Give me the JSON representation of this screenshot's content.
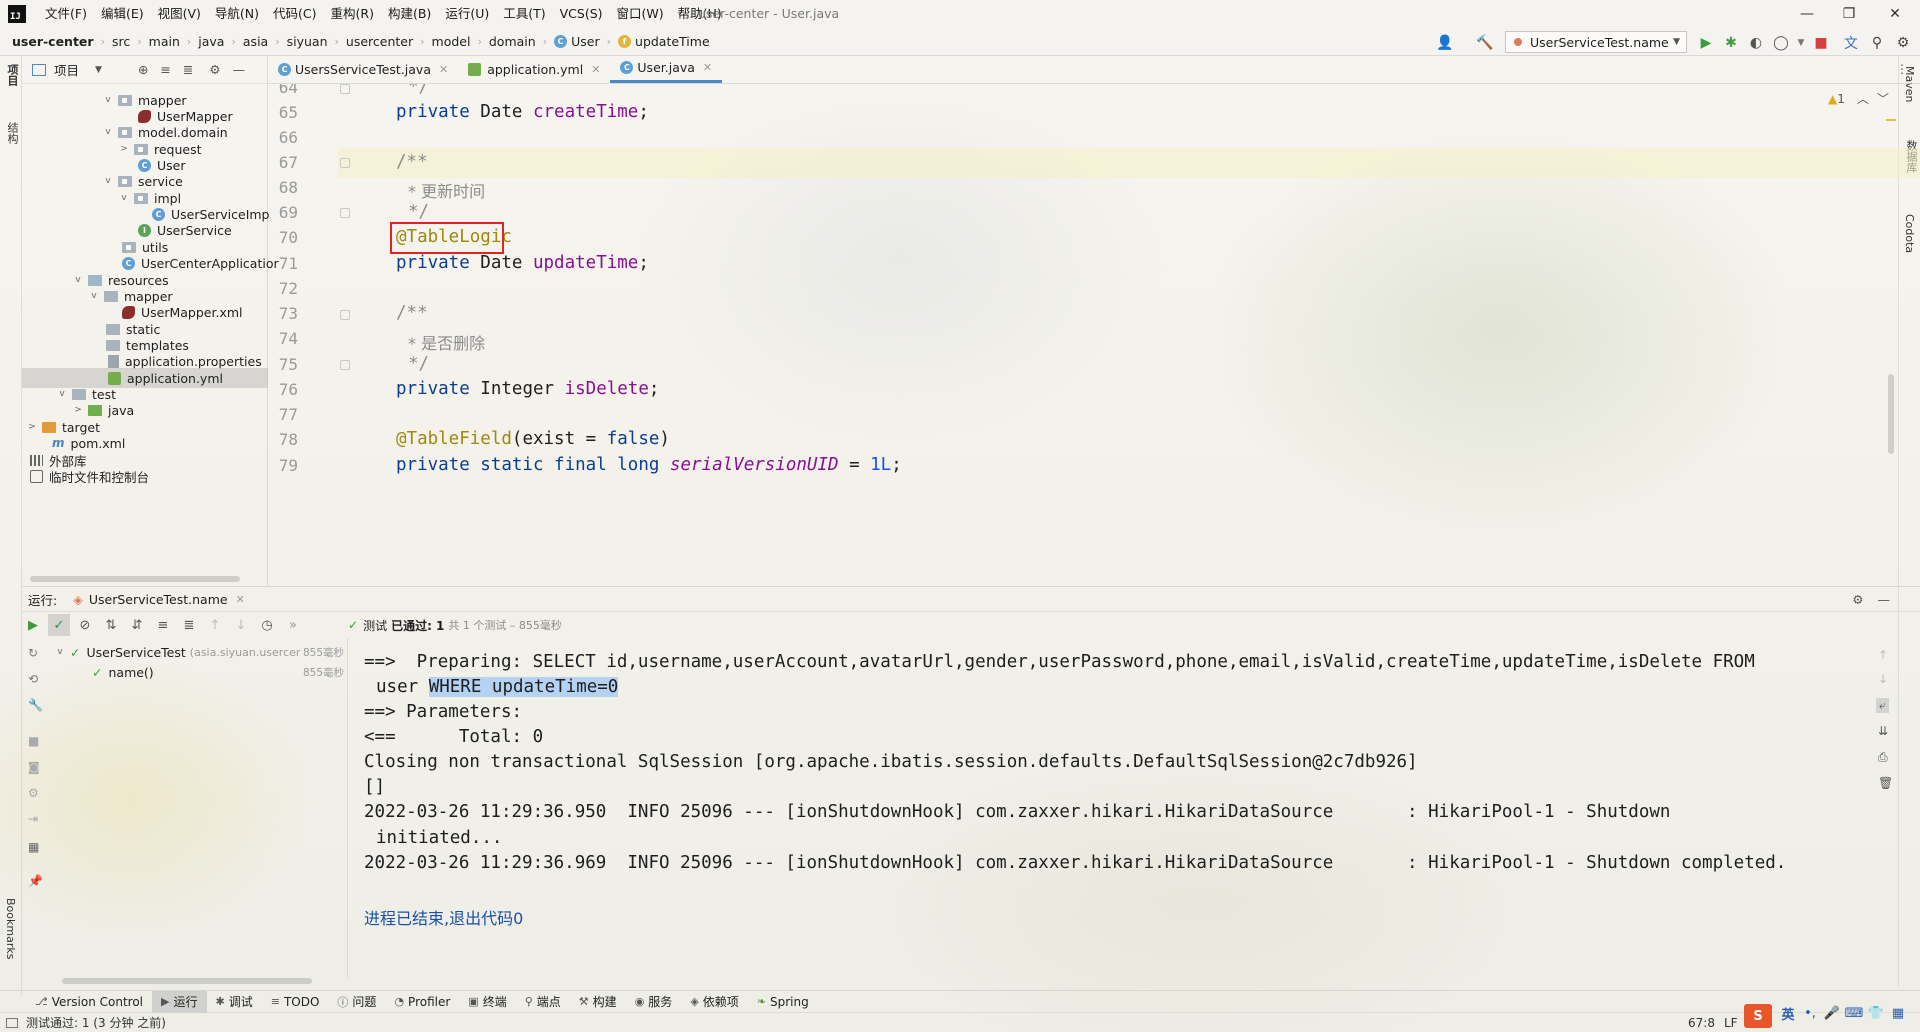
{
  "window": {
    "title": "user-center - User.java",
    "app_logo": "IJ"
  },
  "menu": [
    "文件(F)",
    "编辑(E)",
    "视图(V)",
    "导航(N)",
    "代码(C)",
    "重构(R)",
    "构建(B)",
    "运行(U)",
    "工具(T)",
    "VCS(S)",
    "窗口(W)",
    "帮助(H)"
  ],
  "breadcrumb": [
    "user-center",
    "src",
    "main",
    "java",
    "asia",
    "siyuan",
    "usercenter",
    "model",
    "domain",
    "User",
    "updateTime"
  ],
  "run_config": "UserServiceTest.name",
  "left_strip": {
    "project": "项目",
    "structure": "结构",
    "bookmarks": "Bookmarks"
  },
  "right_strip": {
    "maven": "Maven",
    "database": "数据库",
    "codota": "Codota"
  },
  "project_panel": {
    "title": "项目",
    "tree": [
      {
        "label": "mapper",
        "icon": "folder-icon"
      },
      {
        "label": "UserMapper",
        "icon": "mapper-icon"
      },
      {
        "label": "model.domain",
        "icon": "folder-icon"
      },
      {
        "label": "request",
        "icon": "folder-icon"
      },
      {
        "label": "User",
        "icon": "class-icon"
      },
      {
        "label": "service",
        "icon": "folder-icon"
      },
      {
        "label": "impl",
        "icon": "folder-icon"
      },
      {
        "label": "UserServiceImp",
        "icon": "class-icon"
      },
      {
        "label": "UserService",
        "icon": "interface-icon"
      },
      {
        "label": "utils",
        "icon": "folder-icon"
      },
      {
        "label": "UserCenterApplicatior",
        "icon": "class-icon"
      },
      {
        "label": "resources",
        "icon": "resources-folder-icon"
      },
      {
        "label": "mapper",
        "icon": "folder-icon"
      },
      {
        "label": "UserMapper.xml",
        "icon": "mybatis-xml-icon"
      },
      {
        "label": "static",
        "icon": "folder-icon"
      },
      {
        "label": "templates",
        "icon": "folder-icon"
      },
      {
        "label": "application.properties",
        "icon": "properties-icon"
      },
      {
        "label": "application.yml",
        "icon": "yaml-icon"
      },
      {
        "label": "test",
        "icon": "folder-icon"
      },
      {
        "label": "java",
        "icon": "test-folder-icon"
      },
      {
        "label": "target",
        "icon": "excluded-folder-icon"
      },
      {
        "label": "pom.xml",
        "icon": "maven-icon"
      },
      {
        "label": "外部库",
        "icon": "library-icon"
      },
      {
        "label": "临时文件和控制台",
        "icon": "scratch-icon"
      }
    ]
  },
  "tabs": [
    {
      "label": "UsersServiceTest.java",
      "active": false
    },
    {
      "label": "application.yml",
      "active": false
    },
    {
      "label": "User.java",
      "active": true
    }
  ],
  "editor": {
    "warning_count": "1",
    "lines": [
      {
        "n": "64",
        "text": "*/"
      },
      {
        "n": "65",
        "text": "private Date createTime;"
      },
      {
        "n": "66",
        "text": ""
      },
      {
        "n": "67",
        "text": "/**"
      },
      {
        "n": "68",
        "text": "* 更新时间"
      },
      {
        "n": "69",
        "text": "*/"
      },
      {
        "n": "70",
        "text": "@TableLogic"
      },
      {
        "n": "71",
        "text": "private Date updateTime;"
      },
      {
        "n": "72",
        "text": ""
      },
      {
        "n": "73",
        "text": "/**"
      },
      {
        "n": "74",
        "text": "* 是否删除"
      },
      {
        "n": "75",
        "text": "*/"
      },
      {
        "n": "76",
        "text": "private Integer isDelete;"
      },
      {
        "n": "77",
        "text": ""
      },
      {
        "n": "78",
        "text": "@TableField(exist = false)"
      },
      {
        "n": "79",
        "text": "private static final long serialVersionUID = 1L;"
      }
    ]
  },
  "run_panel": {
    "label": "运行:",
    "tab": "UserServiceTest.name",
    "status_prefix": "测试",
    "status_bold": "已通过: 1",
    "status_rest": "共 1 个测试 – 855毫秒",
    "tests": [
      {
        "name": "UserServiceTest",
        "detail": "(asia.siyuan.usercer",
        "time": "855毫秒"
      },
      {
        "name": "name()",
        "detail": "",
        "time": "855毫秒"
      }
    ]
  },
  "console": {
    "lines": [
      "==>  Preparing: SELECT id,username,userAccount,avatarUrl,gender,userPassword,phone,email,isValid,createTime,updateTime,isDelete FROM",
      "user ",
      "WHERE updateTime=0",
      "==> Parameters: ",
      "<==      Total: 0",
      "Closing non transactional SqlSession [org.apache.ibatis.session.defaults.DefaultSqlSession@2c7db926]",
      "[]",
      "2022-03-26 11:29:36.950  INFO 25096 --- [ionShutdownHook] com.zaxxer.hikari.HikariDataSource       : HikariPool-1 - Shutdown",
      "initiated...",
      "2022-03-26 11:29:36.969  INFO 25096 --- [ionShutdownHook] com.zaxxer.hikari.HikariDataSource       : HikariPool-1 - Shutdown completed.",
      "进程已结束,退出代码0"
    ]
  },
  "bottom_tools": [
    "Version Control",
    "运行",
    "调试",
    "TODO",
    "问题",
    "Profiler",
    "终端",
    "端点",
    "构建",
    "服务",
    "依赖项",
    "Spring"
  ],
  "status_bar": {
    "message": "测试通过: 1 (3 分钟 之前)",
    "position": "67:8",
    "line_sep": "LF",
    "ime": "英"
  }
}
